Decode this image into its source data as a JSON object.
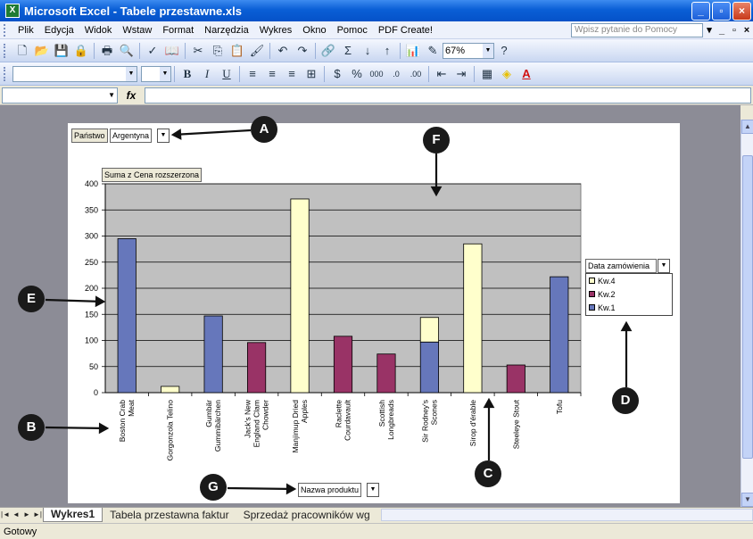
{
  "window": {
    "title": "Microsoft Excel - Tabele przestawne.xls",
    "min": "_",
    "max": "▫",
    "close": "×"
  },
  "menu": {
    "items": [
      "Plik",
      "Edycja",
      "Widok",
      "Wstaw",
      "Format",
      "Narzędzia",
      "Wykres",
      "Okno",
      "Pomoc",
      "PDF Create!"
    ],
    "help_placeholder": "Wpisz pytanie do Pomocy"
  },
  "toolbar": {
    "zoom": "67%"
  },
  "formula": {
    "fx": "fx"
  },
  "pivot": {
    "page_field_label": "Państwo",
    "page_field_value": "Argentyna",
    "data_field_label": "Suma z Cena rozszerzona",
    "series_field_label": "Data zamówienia",
    "category_field_label": "Nazwa produktu"
  },
  "legend": [
    {
      "name": "Kw.4",
      "color": "#FFFFCC"
    },
    {
      "name": "Kw.2",
      "color": "#993366"
    },
    {
      "name": "Kw.1",
      "color": "#6677BB"
    }
  ],
  "chart_data": {
    "type": "bar",
    "stacked": true,
    "categories": [
      "Boston Crab Meat",
      "Gorgonzola Telino",
      "Gumbär Gummibärchen",
      "Jack's New England Clam Chowder",
      "Manjimup Dried Apples",
      "Raclette Courdavault",
      "Scottish Longbreads",
      "Sir Rodney's Scones",
      "Sirop d'érable",
      "Steeleye Stout",
      "Tofu"
    ],
    "category_lines": [
      [
        "Boston Crab",
        "Meat"
      ],
      [
        "Gorgonzola Telino"
      ],
      [
        "Gumbär",
        "Gummibärchen"
      ],
      [
        "Jack's New",
        "England Clam",
        "Chowder"
      ],
      [
        "Manjimup Dried",
        "Apples"
      ],
      [
        "Raclette",
        "Courdavault"
      ],
      [
        "Scottish",
        "Longbreads"
      ],
      [
        "Sir Rodney's",
        "Scones"
      ],
      [
        "Sirop d'érable"
      ],
      [
        "Steeleye Stout"
      ],
      [
        "Tofu"
      ]
    ],
    "series": [
      {
        "name": "Kw.1",
        "color": "#6677BB",
        "values": [
          295,
          0,
          147,
          0,
          0,
          0,
          0,
          97,
          0,
          0,
          222
        ]
      },
      {
        "name": "Kw.2",
        "color": "#993366",
        "values": [
          0,
          0,
          0,
          96,
          0,
          108,
          74,
          0,
          0,
          53,
          0
        ]
      },
      {
        "name": "Kw.4",
        "color": "#FFFFCC",
        "values": [
          0,
          12,
          0,
          0,
          371,
          0,
          0,
          47,
          285,
          0,
          0
        ]
      }
    ],
    "ylim": [
      0,
      400
    ],
    "yticks": [
      0,
      50,
      100,
      150,
      200,
      250,
      300,
      350,
      400
    ],
    "plot_bg": "#C0C0C0",
    "grid": true,
    "legend_position": "right"
  },
  "callouts": [
    "A",
    "B",
    "C",
    "D",
    "E",
    "F",
    "G"
  ],
  "sheets": {
    "tabs": [
      "Wykres1",
      "Tabela przestawna faktur",
      "Sprzedaż pracowników wg"
    ],
    "nav": [
      "|◄",
      "◄",
      "►",
      "►|"
    ]
  },
  "status": {
    "text": "Gotowy"
  }
}
